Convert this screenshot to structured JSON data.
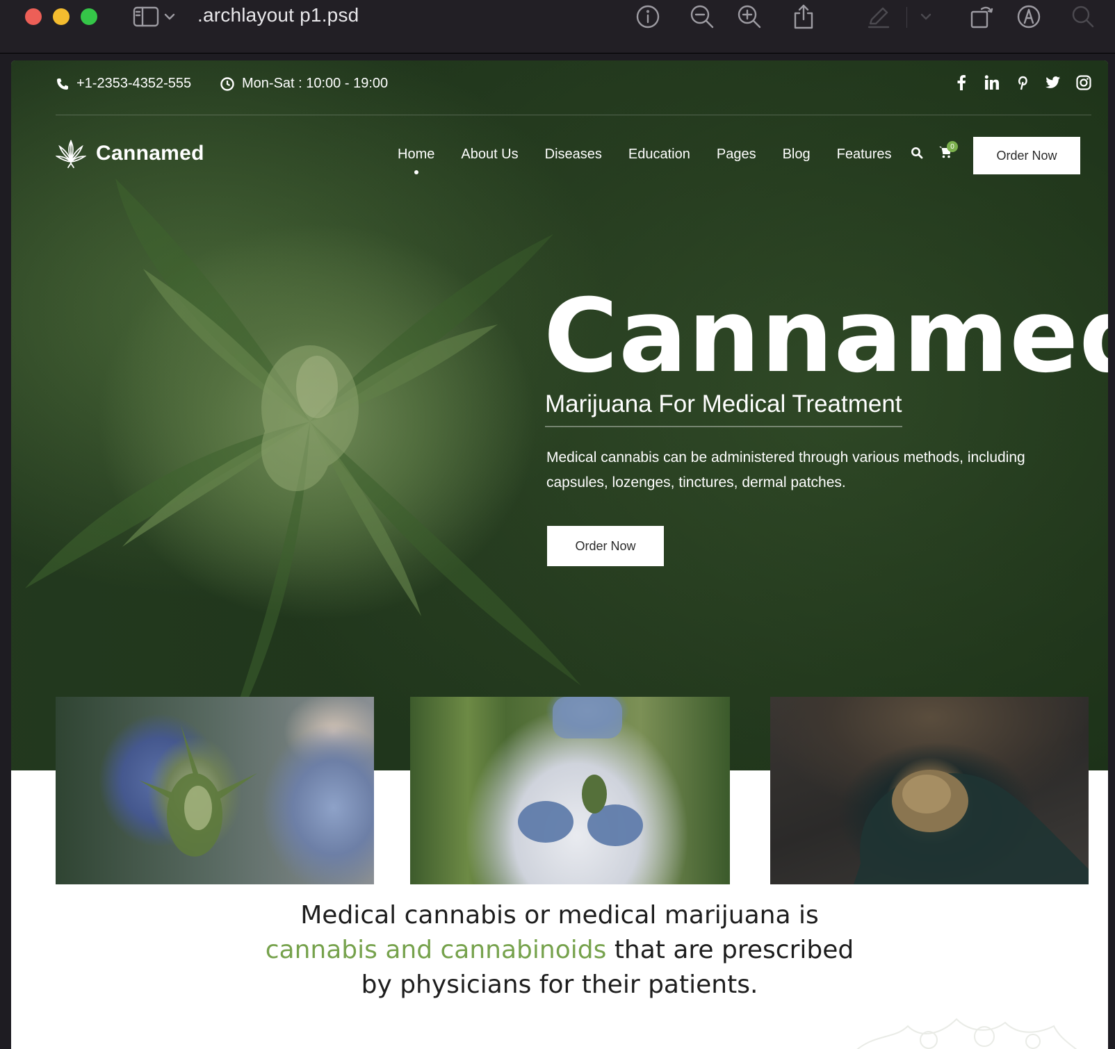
{
  "window": {
    "doc_title": ".archlayout p1.psd",
    "toolbar_icons": [
      "sidebar-icon",
      "chevron-down-icon",
      "info-icon",
      "zoom-out-icon",
      "zoom-in-icon",
      "share-icon",
      "markup-pen-icon",
      "chevron-down-icon",
      "rotate-icon",
      "annotate-icon",
      "search-icon"
    ]
  },
  "site": {
    "topbar": {
      "phone": "+1-2353-4352-555",
      "hours": "Mon-Sat : 10:00 - 19:00",
      "socials": [
        "facebook-icon",
        "linkedin-icon",
        "pinterest-icon",
        "twitter-icon",
        "instagram-icon"
      ]
    },
    "logo": "Cannamed",
    "nav": {
      "items": [
        "Home",
        "About Us",
        "Diseases",
        "Education",
        "Pages",
        "Blog",
        "Features"
      ],
      "active": "Home",
      "cart_count": "0",
      "order_label": "Order Now"
    },
    "hero": {
      "title": "Cannamed",
      "subtitle": "Marijuana For Medical Treatment",
      "description": "Medical cannabis can be administered through various methods, including capsules, lozenges, tinctures, dermal patches.",
      "button_label": "Order Now"
    },
    "tagline": {
      "part1": "Medical cannabis or medical marijuana is",
      "highlight": "cannabis and cannabinoids",
      "part2": "that are prescribed",
      "part3": "by physicians for their patients."
    }
  },
  "colors": {
    "hero_green": "#2f4a27",
    "accent_green": "#76a24c",
    "titlebar": "#221f25",
    "traffic_red": "#ed5f57",
    "traffic_yellow": "#f4bc2f",
    "traffic_green": "#35c648"
  }
}
